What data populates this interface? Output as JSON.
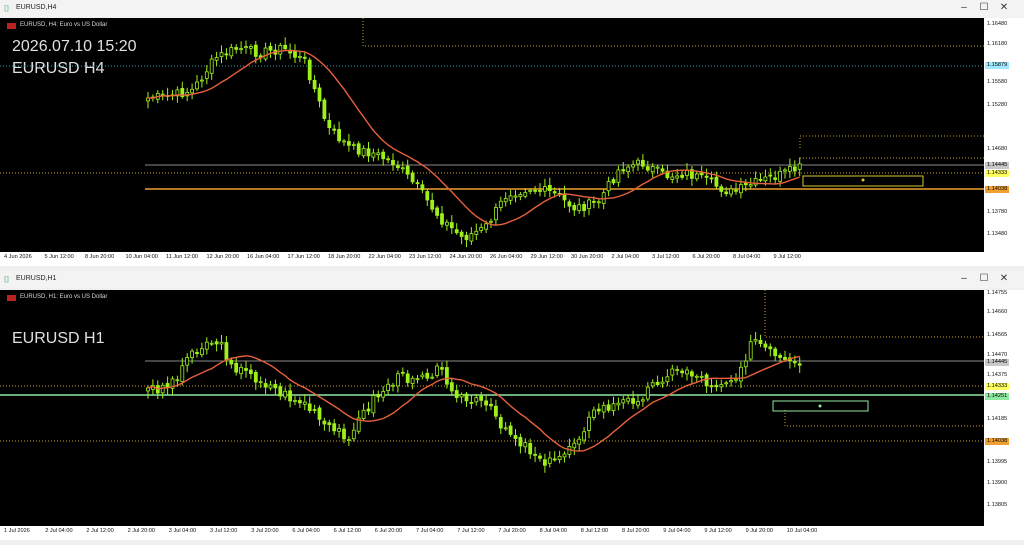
{
  "colors": {
    "background": "#000000",
    "bull": "#9ef01a",
    "ma": "#e8603c",
    "dotted_orange": "#c8a020",
    "support": "#f0a030",
    "resistance_gray": "#8a8a8a",
    "level_green": "#8fe89f",
    "box_yellow": "#d8c830"
  },
  "icons": {
    "window": "chart-window-icon",
    "minimize": "minimize-icon",
    "maximize": "maximize-icon",
    "close": "close-icon",
    "flag": "flag-icon"
  },
  "top": {
    "window_title": "EURUSD,H4",
    "symbol_label": "EURUSD, H4:  Euro vs US Dollar",
    "datetime": "2026.07.10 15:20",
    "caption": "EURUSD H4",
    "price_labels": [
      "1.16480",
      "1.16180",
      "1.15580",
      "1.15280",
      "1.14680",
      "1.13780",
      "1.13480"
    ],
    "price_tags": [
      {
        "text": "1.15879",
        "bg": "#9fe8ff",
        "fg": "#000"
      },
      {
        "text": "1.14445",
        "bg": "#c8c8c8",
        "fg": "#000"
      },
      {
        "text": "1.14333",
        "bg": "#ffff60",
        "fg": "#000"
      },
      {
        "text": "1.14038",
        "bg": "#f0a030",
        "fg": "#000"
      }
    ],
    "time_labels": [
      "4 Jun 2026",
      "5 Jun 12:00",
      "8 Jun 20:00",
      "10 Jun 04:00",
      "11 Jun 12:00",
      "12 Jun 20:00",
      "16 Jun 04:00",
      "17 Jun 12:00",
      "18 Jun 20:00",
      "22 Jun 04:00",
      "23 Jun 12:00",
      "24 Jun 20:00",
      "26 Jun 04:00",
      "29 Jun 12:00",
      "30 Jun 20:00",
      "2 Jul 04:00",
      "3 Jul 12:00",
      "6 Jul 20:00",
      "8 Jul 04:00",
      "9 Jul 12:00"
    ]
  },
  "bottom": {
    "window_title": "EURUSD,H1",
    "symbol_label": "EURUSD, H1:  Euro vs US Dollar",
    "caption": "EURUSD H1",
    "price_labels": [
      "1.14755",
      "1.14660",
      "1.14565",
      "1.14470",
      "1.14375",
      "1.14185",
      "1.13995",
      "1.13900",
      "1.13805"
    ],
    "price_tags": [
      {
        "text": "1.14445",
        "bg": "#c8c8c8",
        "fg": "#000"
      },
      {
        "text": "1.14333",
        "bg": "#ffff60",
        "fg": "#000"
      },
      {
        "text": "1.14251",
        "bg": "#8fe89f",
        "fg": "#000"
      },
      {
        "text": "1.14038",
        "bg": "#f0a030",
        "fg": "#000"
      }
    ],
    "time_labels": [
      "1 Jul 2026",
      "2 Jul 04:00",
      "2 Jul 12:00",
      "2 Jul 20:00",
      "3 Jul 04:00",
      "3 Jul 12:00",
      "3 Jul 20:00",
      "6 Jul 04:00",
      "6 Jul 12:00",
      "6 Jul 20:00",
      "7 Jul 04:00",
      "7 Jul 12:00",
      "7 Jul 20:00",
      "8 Jul 04:00",
      "8 Jul 12:00",
      "8 Jul 20:00",
      "9 Jul 04:00",
      "9 Jul 12:00",
      "9 Jul 20:00",
      "10 Jul 04:00"
    ]
  }
}
